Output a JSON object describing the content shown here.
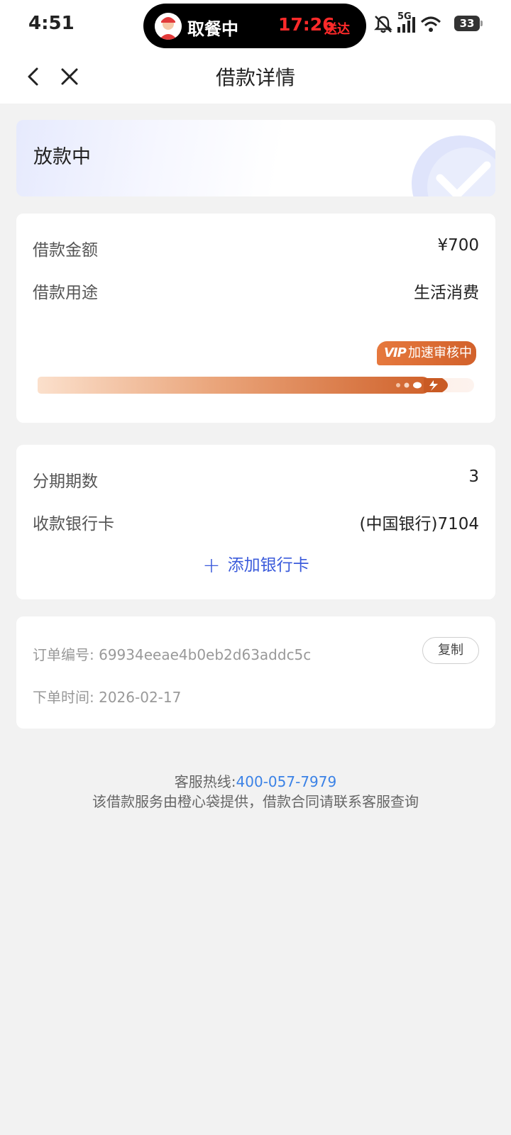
{
  "status_bar": {
    "time": "4:51",
    "island_text": "取餐中",
    "island_eta": "17:26",
    "island_eta_suffix": "送达",
    "network": "5G",
    "battery": "33",
    "icons": [
      "bell-off-icon",
      "signal-icon",
      "wifi-icon",
      "battery-icon"
    ]
  },
  "nav": {
    "title": "借款详情",
    "back_icon": "chevron-left-icon",
    "close_icon": "close-icon"
  },
  "status_card": {
    "label": "放款中",
    "icon": "check-icon"
  },
  "amount_card": {
    "amount_label": "借款金额",
    "amount_value": "¥700",
    "purpose_label": "借款用途",
    "purpose_value": "生活消费",
    "vip_tag": "VIP",
    "vip_text": "加速审核中",
    "progress_fraction": 0.9,
    "colors": {
      "progress": "#d0622b",
      "vip": "#e6793e"
    }
  },
  "install_card": {
    "periods_label": "分期期数",
    "periods_value": "3",
    "bank_label": "收款银行卡",
    "bank_value": "(中国银行)7104",
    "add_card_plus": "+",
    "add_card_label": "添加银行卡",
    "accent": "#3b5bdb"
  },
  "order_card": {
    "order_no_label": "订单编号:",
    "order_no": "69934eeae4b0eb2d63addc5c",
    "copy_label": "复制",
    "order_time_label": "下单时间:",
    "order_time": "2026-02-17"
  },
  "footer": {
    "hotline_label": "客服热线:",
    "hotline_number": "400-057-7979",
    "note": "该借款服务由橙心袋提供，借款合同请联系客服查询"
  }
}
